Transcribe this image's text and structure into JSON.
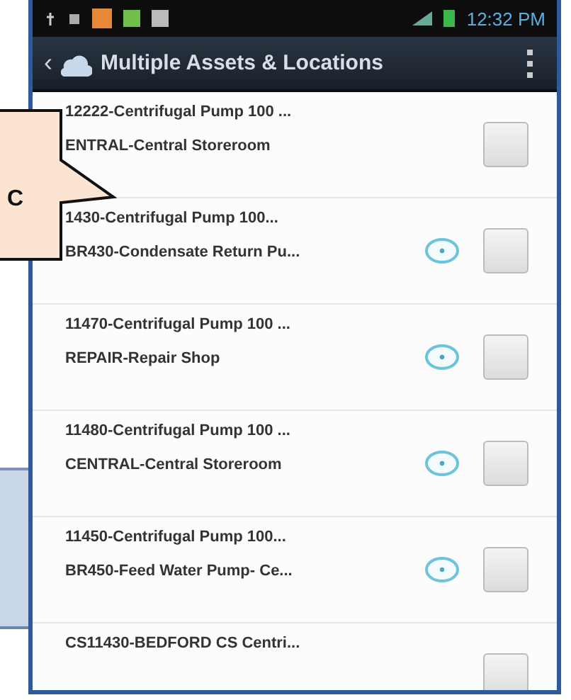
{
  "callout": {
    "text": "C"
  },
  "status_bar": {
    "time": "12:32 PM"
  },
  "title_bar": {
    "back": "‹",
    "title": "Multiple Assets & Locations"
  },
  "rows": [
    {
      "line_1": "12222-Centrifugal Pump 100 ...",
      "line_2": "ENTRAL-Central Storeroom",
      "marker": false,
      "checked": false
    },
    {
      "line_1": "1430-Centrifugal Pump 100...",
      "line_2": "BR430-Condensate Return Pu...",
      "marker": true,
      "checked": false
    },
    {
      "line_1": "11470-Centrifugal Pump 100 ...",
      "line_2": "REPAIR-Repair Shop",
      "marker": true,
      "checked": false
    },
    {
      "line_1": "11480-Centrifugal Pump 100 ...",
      "line_2": "CENTRAL-Central Storeroom",
      "marker": true,
      "checked": false
    },
    {
      "line_1": "11450-Centrifugal Pump 100...",
      "line_2": "BR450-Feed Water Pump- Ce...",
      "marker": true,
      "checked": false
    },
    {
      "line_1": "CS11430-BEDFORD CS Centri...",
      "marker": false,
      "checked": false
    }
  ]
}
